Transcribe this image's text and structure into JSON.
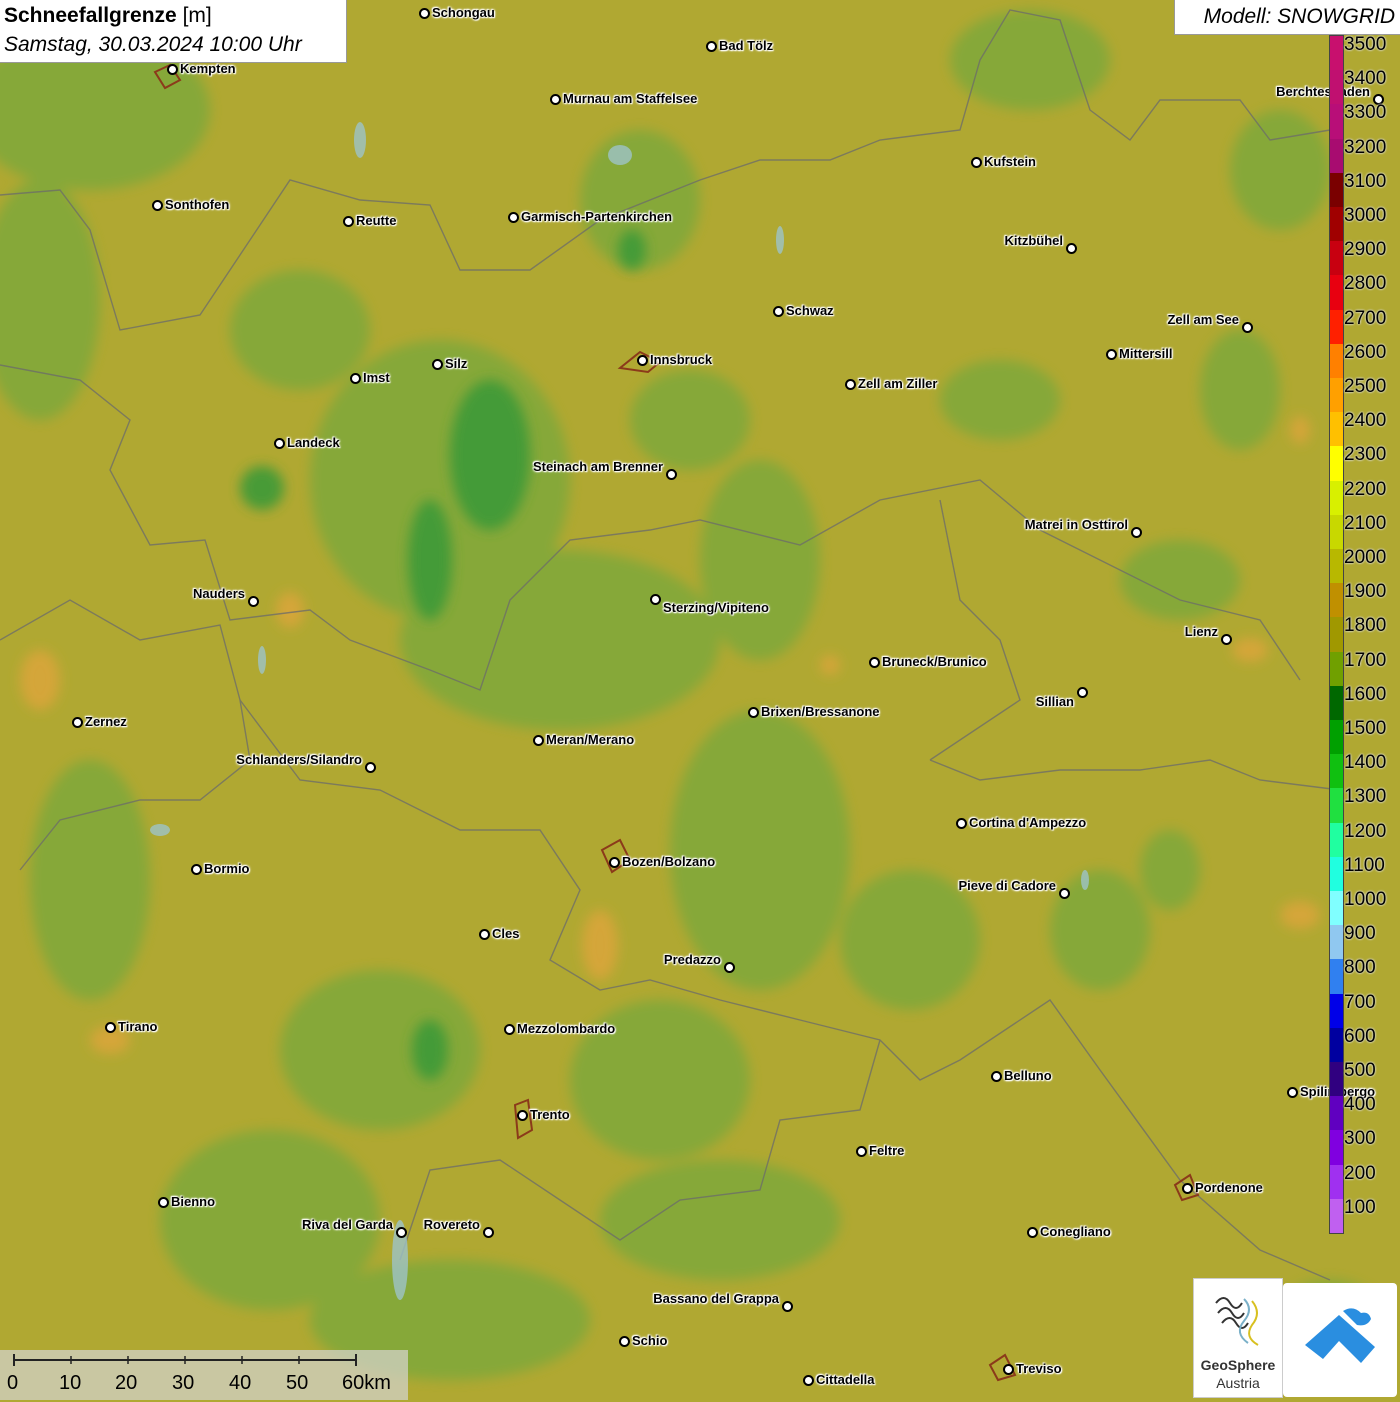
{
  "title": {
    "parameter": "Schneefallgrenze",
    "unit": "[m]",
    "datetime": "Samstag, 30.03.2024 10:00 Uhr"
  },
  "model_label": "Modell: SNOWGRID",
  "cities": [
    {
      "name": "Schongau"
    },
    {
      "name": "Bad Tölz"
    },
    {
      "name": "Kempten"
    },
    {
      "name": "Murnau am Staffelsee"
    },
    {
      "name": "Berchtesgaden"
    },
    {
      "name": "Kufstein"
    },
    {
      "name": "Sonthofen"
    },
    {
      "name": "Reutte"
    },
    {
      "name": "Garmisch-Partenkirchen"
    },
    {
      "name": "Kitzbühel"
    },
    {
      "name": "Schwaz"
    },
    {
      "name": "Zell am See"
    },
    {
      "name": "Mittersill"
    },
    {
      "name": "Silz"
    },
    {
      "name": "Innsbruck"
    },
    {
      "name": "Imst"
    },
    {
      "name": "Zell am Ziller"
    },
    {
      "name": "Landeck"
    },
    {
      "name": "Steinach am Brenner"
    },
    {
      "name": "Matrei in Osttirol"
    },
    {
      "name": "Nauders"
    },
    {
      "name": "Sterzing/Vipiteno"
    },
    {
      "name": "Lienz"
    },
    {
      "name": "Bruneck/Brunico"
    },
    {
      "name": "Sillian"
    },
    {
      "name": "Brixen/Bressanone"
    },
    {
      "name": "Zernez"
    },
    {
      "name": "Meran/Merano"
    },
    {
      "name": "Schlanders/Silandro"
    },
    {
      "name": "Cortina d'Ampezzo"
    },
    {
      "name": "Bozen/Bolzano"
    },
    {
      "name": "Bormio"
    },
    {
      "name": "Pieve di Cadore"
    },
    {
      "name": "Cles"
    },
    {
      "name": "Predazzo"
    },
    {
      "name": "Tirano"
    },
    {
      "name": "Mezzolombardo"
    },
    {
      "name": "Belluno"
    },
    {
      "name": "Spilimbergo"
    },
    {
      "name": "Trento"
    },
    {
      "name": "Feltre"
    },
    {
      "name": "Pordenone"
    },
    {
      "name": "Bienno"
    },
    {
      "name": "Riva del Garda"
    },
    {
      "name": "Rovereto"
    },
    {
      "name": "Conegliano"
    },
    {
      "name": "Bassano del Grappa"
    },
    {
      "name": "Schio"
    },
    {
      "name": "Treviso"
    },
    {
      "name": "Cittadella"
    }
  ],
  "legend": {
    "values": [
      "3500",
      "3400",
      "3300",
      "3200",
      "3100",
      "3000",
      "2900",
      "2800",
      "2700",
      "2600",
      "2500",
      "2400",
      "2300",
      "2200",
      "2100",
      "2000",
      "1900",
      "1800",
      "1700",
      "1600",
      "1500",
      "1400",
      "1300",
      "1200",
      "1100",
      "1000",
      "900",
      "800",
      "700",
      "600",
      "500",
      "400",
      "300",
      "200",
      "100"
    ],
    "colors": [
      "#c8106e",
      "#c01070",
      "#b80e78",
      "#a80c70",
      "#7a0000",
      "#a00000",
      "#c80010",
      "#e80010",
      "#ff2000",
      "#ff8000",
      "#ffa000",
      "#ffc000",
      "#ffff00",
      "#d8f000",
      "#c8d800",
      "#b8b800",
      "#c09000",
      "#a09800",
      "#70a000",
      "#006800",
      "#00a000",
      "#10c010",
      "#20e040",
      "#20ffa0",
      "#20ffe0",
      "#80ffff",
      "#90c8f0",
      "#3080f0",
      "#0000e8",
      "#0000a0",
      "#300080",
      "#6000c0",
      "#8000e0",
      "#a030f0",
      "#c060f0"
    ]
  },
  "scale": {
    "ticks": [
      "0",
      "10",
      "20",
      "30",
      "40",
      "50",
      "60km"
    ]
  },
  "logos": {
    "geosphere_line1": "GeoSphere",
    "geosphere_line2": "Austria"
  }
}
